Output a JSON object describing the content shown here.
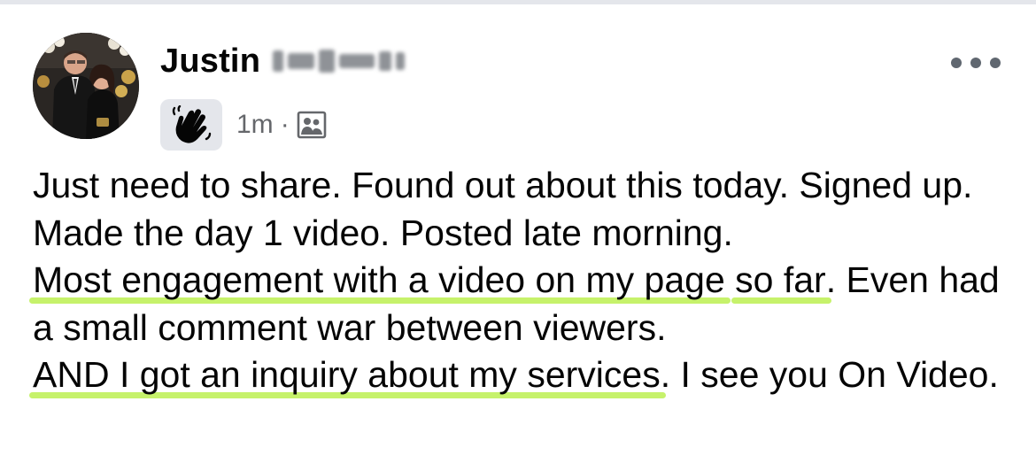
{
  "post": {
    "author": {
      "first_name": "Justin",
      "surname_blurred": true
    },
    "timestamp": "1m",
    "separator": "·",
    "badge_icon": "waving-hand-icon",
    "audience_icon": "friends-audience-icon",
    "more_icon": "more-options-icon",
    "text": {
      "p1": "Just need to share. Found out about this today. Signed up. Made the day 1 video. Posted late morning. ",
      "h1a": "Most engagement with a video on my page",
      "gap1": " ",
      "h1b": "so far",
      "p2": ". Even had a small comment war between viewers. ",
      "h2": "AND I got an inquiry about my services",
      "p3": ". I see you On Video."
    },
    "highlight_color": "#c6f26b"
  }
}
